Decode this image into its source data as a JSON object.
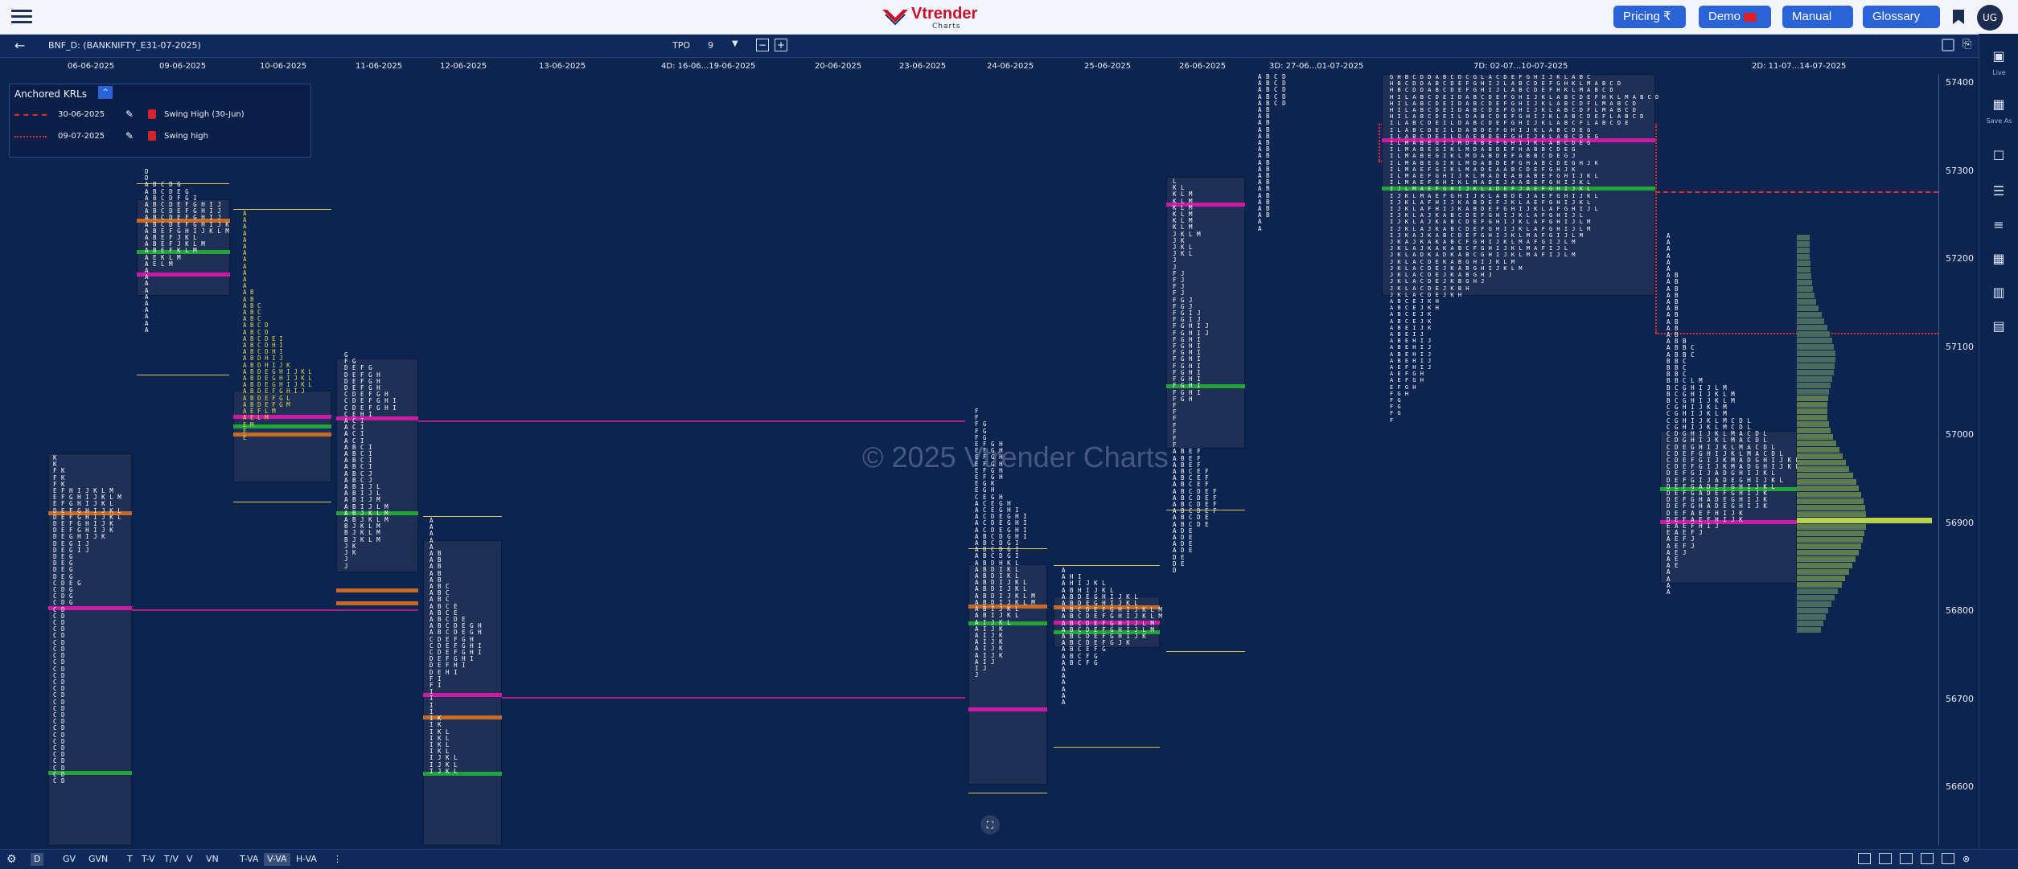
{
  "header": {
    "brand": "Vtrender",
    "brand_sub": "Charts",
    "buttons": {
      "pricing": "Pricing ₹",
      "demo": "Demo",
      "manual": "Manual",
      "glossary": "Glossary"
    },
    "avatar": "UG"
  },
  "toolbar": {
    "symbol": "BNF_D: (BANKNIFTY_E31-07-2025)",
    "tpo_label": "TPO",
    "tpo_value": "9",
    "minus": "−",
    "plus": "+"
  },
  "dates": [
    "06-06-2025",
    "09-06-2025",
    "10-06-2025",
    "11-06-2025",
    "12-06-2025",
    "13-06-2025",
    "4D: 16-06...19-06-2025",
    "20-06-2025",
    "23-06-2025",
    "24-06-2025",
    "25-06-2025",
    "26-06-2025",
    "3D: 27-06...01-07-2025",
    "7D: 02-07...10-07-2025",
    "2D: 11-07...14-07-2025"
  ],
  "krl": {
    "title": "Anchored KRLs",
    "toggle": "^",
    "rows": [
      {
        "date": "30-06-2025",
        "name": "Swing High (30-Jun)",
        "style": "dashed",
        "color": "#e03030"
      },
      {
        "date": "09-07-2025",
        "name": "Swing high",
        "style": "dotted",
        "color": "#e03030"
      }
    ]
  },
  "watermark": "© 2025 Vtrender Charts",
  "y_axis": [
    "57400",
    "57300",
    "57200",
    "57100",
    "57000",
    "56900",
    "56800",
    "56700",
    "56600"
  ],
  "right_panel": {
    "live": "Live",
    "save_as": "Save As"
  },
  "bottom": {
    "items": [
      "D",
      "GV",
      "GVN",
      "T",
      "T-V",
      "T/V",
      "V",
      "VN",
      "T-VA",
      "V-VA",
      "H-VA"
    ],
    "active": [
      "D",
      "V-VA"
    ]
  },
  "profiles": {
    "p1": [
      "K",
      "K",
      "FK",
      "FK",
      "FK",
      "EFHIJKLM",
      "EFGHIJKLM",
      "EFGHIJKL",
      "DEFGHIJKL",
      "DEFGHIJKL",
      "DEFGHIJK",
      "DEFGHIJK",
      "DEGHIJK",
      "DEGIJ",
      "DEGIJ",
      "DEG",
      "DEG",
      "DEG",
      "DEG",
      "CDEG",
      "CDG",
      "CDG",
      "CDG",
      "CD",
      "CD",
      "CD",
      "CD",
      "CD",
      "CD",
      "CD",
      "CD",
      "CD",
      "CD",
      "CD",
      "CD",
      "CD",
      "CD",
      "CD",
      "CD",
      "CD",
      "CD",
      "CD",
      "CD",
      "CD",
      "CD",
      "CD",
      "CD",
      "CD",
      "CD",
      "CD"
    ],
    "p2": [
      "D",
      "D",
      "ABCDG",
      "ABCDEG",
      "ABCDFGI",
      "ABCDEFGHIJ",
      "ABCDEFGHIJ",
      "ABCDEFGHIJ",
      "ABCDEFGHIJK",
      "ABEFGHIJKLM",
      "ABEFJKL",
      "ABEFJKLM",
      "ABEFKLM",
      "AEKLM",
      "AELM",
      "A",
      "A",
      "A",
      "A",
      "A",
      "A",
      "A",
      "A",
      "A",
      "A"
    ],
    "p3": [
      "A",
      "A",
      "A",
      "A",
      "A",
      "A",
      "A",
      "A",
      "A",
      "A",
      "A",
      "A",
      "AB",
      "AB",
      "ABC",
      "ABC",
      "ABC",
      "ABCD",
      "ABCD",
      "ABCDEI",
      "ABCDHI",
      "ABCDHI",
      "ABDHIJ",
      "ABDHIJK",
      "ABDEGHIJKL",
      "ABDEGHIJKL",
      "ABDEGHIJKL",
      "ABDEFGHIJ",
      "ABDEFGL",
      "ABDEFGM",
      "AEFLM",
      "AELM",
      "EM",
      "E",
      "E"
    ],
    "p4": [
      "G",
      "FG",
      "DEFG",
      "DEFGH",
      "DEFGH",
      "DEFGH",
      "CDEFGH",
      "CDEFGHI",
      "CDEFGHI",
      "CEHI",
      "ACI",
      "ACI",
      "ACI",
      "ACI",
      "ABCI",
      "ABCI",
      "ABCI",
      "ABCI",
      "ABCJ",
      "ABCJ",
      "ABIJL",
      "ABIJL",
      "ABIJM",
      "ABIJLM",
      "ABJKLM",
      "ABJKLM",
      "BJKLM",
      "BJKLM",
      "BJKLM",
      "JK",
      "JK",
      "J",
      "J"
    ],
    "p5": [
      "A",
      "A",
      "A",
      "A",
      "A",
      "AB",
      "AB",
      "AB",
      "AB",
      "AB",
      "ABC",
      "ABC",
      "ABC",
      "ABCE",
      "ABCE",
      "ABCDE",
      "ABCDEGH",
      "ABCDEGH",
      "CDEFGH",
      "CDEFGHI",
      "CDEFGHI",
      "DEFGHI",
      "DEFHI",
      "DEHI",
      "FI",
      "FI",
      "I",
      "I",
      "I",
      "I",
      "IK",
      "IK",
      "IKL",
      "IKL",
      "IKL",
      "IKL",
      "IJKL",
      "IJKL",
      "IJKL"
    ],
    "p6": [
      "F",
      "F",
      "FG",
      "FG",
      "FG",
      "EFGH",
      "EFGH",
      "EFGH",
      "EFGH",
      "EFGH",
      "EFGH",
      "EGK",
      "EGH",
      "CEGH",
      "ACEGH",
      "ACEGHI",
      "ACDEGHI",
      "ACDEGHI",
      "ACDEGHI",
      "ABCDGHI",
      "ABCDGI",
      "ABCDGI",
      "ABCDGI",
      "ABDHKL",
      "ABDIKL",
      "ABDIKL",
      "ABDIJKL",
      "ABDIJKL",
      "ABDIJKLM",
      "ABDIJKLM",
      "ABIJKL",
      "ABIJKL",
      "AIJKL",
      "AIJK",
      "AIJK",
      "AIJK",
      "AIJK",
      "AIJK",
      "AIJ",
      "IJ",
      "J"
    ],
    "p7": [
      "A",
      "AHI",
      "AHIJKL",
      "ABHIJKL",
      "ABDEGHIJKL",
      "ABDEGHIJKL",
      "ABCDEFGHIJKLM",
      "ABCDEFGHIJKLM",
      "ABCDEFGHIJLM",
      "ABCDEFGHIJLM",
      "ABCDEFGHIJK",
      "ABCDEFGJK",
      "ABCEFG",
      "ABCFG",
      "ABCFG",
      "A",
      "A",
      "A",
      "A",
      "A",
      "A"
    ],
    "p8": [
      "L",
      "KL",
      "KLM",
      "KLM",
      "KLM",
      "KLM",
      "KLM",
      "KLM",
      "JKLM",
      "JK",
      "JKL",
      "JKL",
      "J",
      "J",
      "FJ",
      "FJ",
      "FJ",
      "FJ",
      "FGJ",
      "FGJ",
      "FGIJ",
      "FGIJ",
      "FGHIJ",
      "FGHIJ",
      "FGHI",
      "FGHI",
      "FGHI",
      "FGHI",
      "FGHI",
      "FGHI",
      "FGHI",
      "FGHI",
      "FGHI",
      "FGH",
      "F",
      "F",
      "F",
      "F",
      "F",
      "F",
      "F",
      "ABEF",
      "ABEF",
      "ABEF",
      "ABCEF",
      "ABCEF",
      "ABCEF",
      "ABCDEF",
      "ABCDEF",
      "ABCDEF",
      "ABCDEF",
      "ABCDE",
      "ABCDE",
      "ADE",
      "ADE",
      "ADE",
      "ADE",
      "DE",
      "DE",
      "D"
    ],
    "p9": [
      "ABCD",
      "ABCD",
      "ABCD",
      "ABCD",
      "ABCD",
      "AB",
      "AB",
      "AB",
      "AB",
      "AB",
      "AB",
      "AB",
      "AB",
      "AB",
      "AB",
      "AB",
      "AB",
      "AB",
      "AB",
      "AB",
      "AB",
      "AB",
      "A",
      "A"
    ],
    "p10": [
      "GHBCDDABCDCGLACDEFGHIJKLABC",
      "HBCDDABCDEFGHIJLABCDEFGHKLMABCD",
      "HBCDDABCDEFGHIJLABCDEFHKLMABCD",
      "HILABCDEIDABCDEFGHIJKLABCDEFHKLMABCD",
      "HILABCDEIDABCDEFGHIJKLABCDFLMABCD",
      "HILABCDEIDABCDEFGHIJKLABCDFLMABCD",
      "HILABCDEILDABCDEFGHIJKLABCDEFLABCD",
      "ILABCDEILDABCDEFGHIJKLABCFLABCDE",
      "ILABCDEILDABDEFGHIJKLABCDEG",
      "ILABCDEILDAEBDEFGHIJKLABCDEG",
      "ILMABEGIJMDABEFGHIJKLABCDEG",
      "ILMABEGIKLMDABDEFHABBCDEG",
      "ILMABEGIKLMDABDEFABBCDEGJ",
      "ILMABEGIKLMDABDEFGHABCDEGHJK",
      "ILMAEFGIKLMADEAABCDEFGHJK",
      "ILMAEFGHIJKLMADEABABEFGHIJKL",
      "ILMAEFGHIKLMADEJAABEFGHIJKL",
      "IJLMAEFGHIJKLADEFJAEFGHIJKL",
      "IJKLMAEFGHIJKLABDEJAEFGHIJKL",
      "IJKLAFHIJKABDEFJKLAEFGHIJKL",
      "IJKLAFHIJKABDEFGHIJKLAFGHIJL",
      "IJKLAJKABCDEFGHIJKLAFGHIJL",
      "IJKLAJKABCDEFGHIJKLAFGHIJLM",
      "IJKLAJKABCDEFGHIJKLAFGHIJLM",
      "IJKAJKABCDEFGHIJKLMAFGIJLM",
      "JKAJKAKABCFGHIJKLMAFGIJLM",
      "JKLAJKAKABCFGHIJKLMAFIJL",
      "JKLADKADKABCGHIJKLMAFIJLM",
      "JKLACDEKABGHIJKLM",
      "JKLACDEJKABGHIJKLM",
      "JKLACDEJKABGHJ",
      "JKLACDEJKBGHJ",
      "JKLACDEJKBH",
      "JKLACDEJKH",
      "ABCEJKH",
      "ABCEJKH",
      "ABCEJK",
      "ABCEJK",
      "ABEIJK",
      "ABEIJ",
      "ABEHIJ",
      "ABEHIJ",
      "ABEHIJ",
      "ABEHIJ",
      "AEFHIJ",
      "AEFGH",
      "AEFGH",
      "EFGH",
      "FGH",
      "FG",
      "FG",
      "FG",
      "F"
    ],
    "p11": [
      "A",
      "A",
      "A",
      "A",
      "A",
      "A",
      "AB",
      "AB",
      "AB",
      "AB",
      "AB",
      "AB",
      "AB",
      "AB",
      "AB",
      "AB",
      "ABB",
      "ABBC",
      "ABBC",
      "BBC",
      "BBC",
      "BBC",
      "BBCLM",
      "BCGHIJLM",
      "BCGHIJKLM",
      "BCGHIJKLM",
      "CGHIJKLM",
      "CGHIJKLM",
      "CGHIJKLMCDL",
      "CGHIJKLMCDL",
      "CDGHIJKLMACDL",
      "CDGHIJKLMACDL",
      "CDEGHIJKLMACDL",
      "CDEFGHIJKLMACDL",
      "CDEFGIJKMADGHIJKL",
      "CDEFGIJKMADGHIJKL",
      "DEFGIJADGHIJKL",
      "DEFGIJADEGHIJKL",
      "DEFGADEFGHIJKL",
      "DEFGADEFGHIJK",
      "DEFGHADEGHIJK",
      "DEFGHADEGHIJK",
      "DEFAEFHIJK",
      "DEFAEFHIJK",
      "EAEFHIJ",
      "EAEFJ",
      "AEFJ",
      "AEFJ",
      "AEJ",
      "AE",
      "AE",
      "A",
      "A",
      "A",
      "A"
    ]
  }
}
